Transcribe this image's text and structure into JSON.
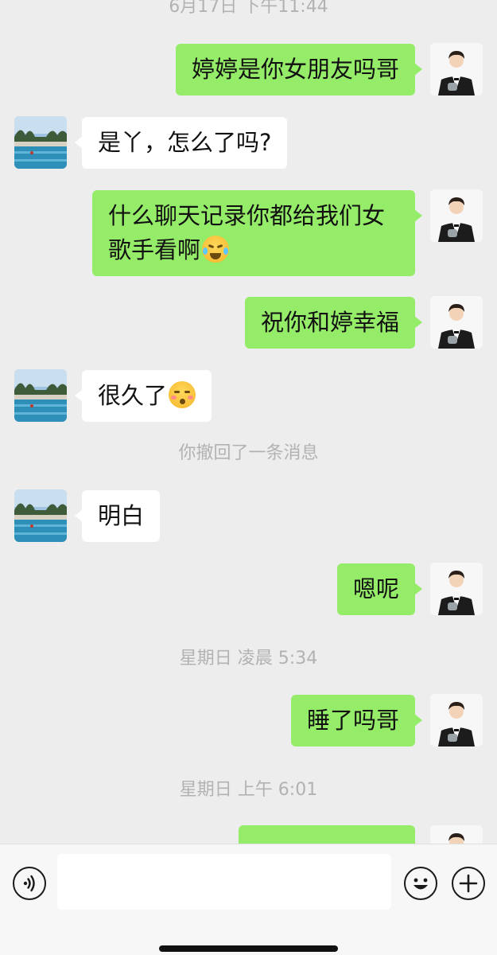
{
  "chat": {
    "timestamps": [
      "6月17日 下午11:44",
      "星期日 凌晨 5:34",
      "星期日 上午 6:01"
    ],
    "recall_notice": "你撤回了一条消息",
    "messages": [
      {
        "from": "me",
        "text": "婷婷是你女朋友吗哥"
      },
      {
        "from": "them",
        "text": "是丫，怎么了吗?"
      },
      {
        "from": "me",
        "text": "什么聊天记录你都给我们女歌手看啊",
        "emoji": "crying-laughing-emoji"
      },
      {
        "from": "me",
        "text": "祝你和婷幸福"
      },
      {
        "from": "them",
        "text": "很久了",
        "emoji": "kissing-closed-eyes-emoji"
      },
      {
        "from": "them",
        "text": "明白"
      },
      {
        "from": "me",
        "text": "嗯呢"
      },
      {
        "from": "me",
        "text": "睡了吗哥"
      }
    ]
  },
  "input_bar": {
    "voice_icon": "voice-icon",
    "emoji_icon": "emoji-icon",
    "add_icon": "plus-icon",
    "input_value": ""
  }
}
